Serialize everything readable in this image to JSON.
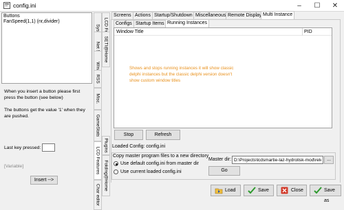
{
  "window": {
    "title": "config.ini",
    "min": "–",
    "max": "☐",
    "close": "✕"
  },
  "buttons_list": {
    "lines": [
      "Buttons",
      "FanSpeed(1,1) (nr,divider)"
    ]
  },
  "left": {
    "info1": "When you insert a button please first press the button (see below)",
    "info2": "The buttons get the value '1' when they are pushed.",
    "last_key_label": "Last key pressed:",
    "last_key_value": "",
    "variable_label": "[Variable]",
    "insert_button": "Insert -->"
  },
  "vertical_tabs": [
    "SysInfo",
    "Net Stats",
    "Winamp",
    "RSS",
    "Misc.",
    "GameStats",
    "LCD Features",
    "SETI@Home",
    "Plugins",
    "Folding@Home",
    "Char editor"
  ],
  "top_tabs": [
    "Screens",
    "Actions",
    "Startup/Shutdown",
    "Miscellaneous",
    "Remote Display",
    "Multi Instance"
  ],
  "sub_tabs": [
    "Configs",
    "Startup Items",
    "Running Instances"
  ],
  "listview": {
    "col1": "Window Title",
    "col2": "PID",
    "note": "Shows and stops running instances it will show classic delphi instances but the classic delphi version doesn't show custom window titles"
  },
  "actions": {
    "stop": "Stop",
    "refresh": "Refresh"
  },
  "loaded_config": "Loaded Config:  config.ini",
  "copy_group": {
    "label": "Copy master program files to a new directory",
    "opt1": "Use default config.ini from master dir",
    "opt2": "Use current loaded config.ini",
    "master_dir_label": "Master dir:",
    "master_dir_value": "D:\\Projects\\lcdsmartie-laz-hydrolisk-mod\\release",
    "browse": "...",
    "go": "Go"
  },
  "bottom": {
    "load": "Load",
    "save": "Save",
    "close": "Close",
    "save_as": "Save as"
  },
  "colors": {
    "note": "#e8901c",
    "save_green": "#2e9a2e",
    "close_red": "#d23a2a"
  }
}
